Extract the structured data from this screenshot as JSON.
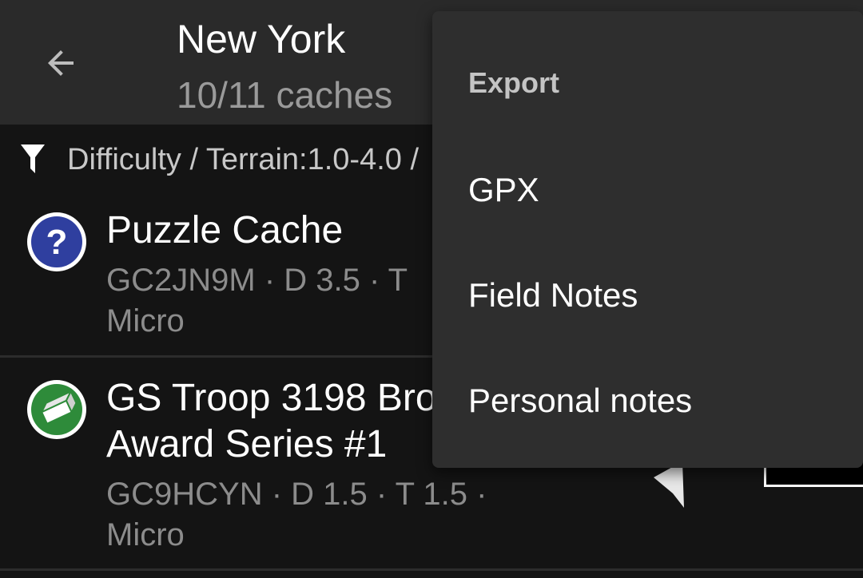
{
  "header": {
    "title": "New York",
    "subtitle": "10/11 caches",
    "back_icon": "arrow-back-icon"
  },
  "filter": {
    "icon": "filter-icon",
    "text": "Difficulty / Terrain:1.0-4.0 /"
  },
  "caches": [
    {
      "name": "Puzzle Cache",
      "meta": "GC2JN9M · D 3.5 · T",
      "size": "Micro",
      "icon": "mystery-cache-icon",
      "icon_color": "#2f3f9f"
    },
    {
      "name": "GS Troop 3198 Bro",
      "name_line2": "Award Series #1",
      "meta": "GC9HCYN · D 1.5 · T 1.5 ·",
      "size": "Micro",
      "icon": "traditional-cache-icon",
      "icon_color": "#2e8b3a",
      "distance_partial": "0"
    }
  ],
  "export_menu": {
    "header": "Export",
    "items": [
      {
        "label": "GPX"
      },
      {
        "label": "Field Notes"
      },
      {
        "label": "Personal notes"
      }
    ]
  },
  "colors": {
    "appbar": "#2a2a2a",
    "background": "#141414",
    "menu": "#2e2e2e",
    "secondary_text": "#8c8c8c"
  }
}
